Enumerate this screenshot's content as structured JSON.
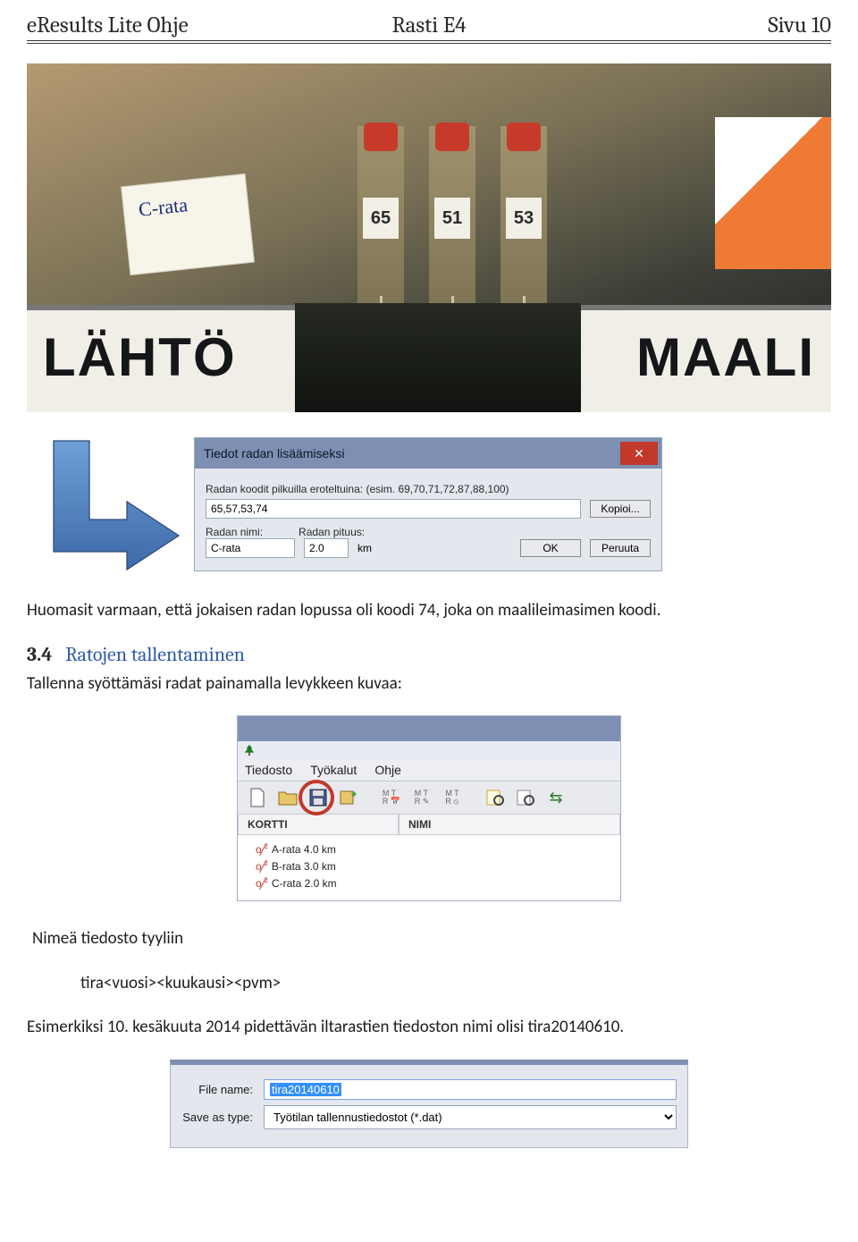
{
  "header": {
    "left": "eResults Lite Ohje",
    "center": "Rasti E4",
    "right": "Sivu 10"
  },
  "photo": {
    "card_label": "C-rata",
    "sticks": [
      "65",
      "51",
      "53"
    ],
    "sign_left": "LÄHTÖ",
    "sign_right": "MAALI"
  },
  "dialog": {
    "title": "Tiedot radan lisäämiseksi",
    "codes_label": "Radan koodit pilkuilla eroteltuina: (esim. 69,70,71,72,87,88,100)",
    "codes_value": "65,57,53,74",
    "copy_btn": "Kopioi...",
    "name_label": "Radan nimi:",
    "name_value": "C-rata",
    "length_label": "Radan pituus:",
    "length_value": "2.0",
    "length_unit": "km",
    "ok_btn": "OK",
    "cancel_btn": "Peruuta"
  },
  "body": {
    "p1": "Huomasit varmaan, että jokaisen radan lopussa oli koodi 74, joka on maalileimasimen koodi.",
    "section_num": "3.4",
    "section_title": "Ratojen tallentaminen",
    "p2": "Tallenna syöttämäsi radat painamalla levykkeen kuvaa:"
  },
  "app": {
    "menu": [
      "Tiedosto",
      "Työkalut",
      "Ohje"
    ],
    "col1": "KORTTI",
    "col2": "NIMI",
    "tree": [
      "A-rata 4.0 km",
      "B-rata 3.0 km",
      "C-rata 2.0 km"
    ]
  },
  "body2": {
    "p3": "Nimeä tiedosto tyyliin",
    "p4": "tira<vuosi><kuukausi><pvm>",
    "p5": "Esimerkiksi 10. kesäkuuta 2014 pidettävän iltarastien tiedoston nimi olisi tira20140610."
  },
  "file": {
    "name_label": "File name:",
    "name_value": "tira20140610",
    "type_label": "Save as type:",
    "type_value": "Työtilan tallennustiedostot (*.dat)"
  }
}
